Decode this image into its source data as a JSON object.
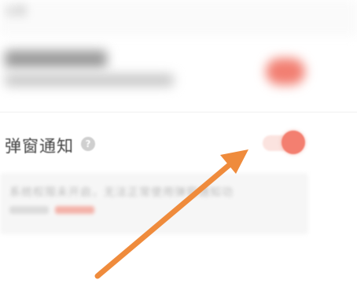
{
  "header": {
    "faint_text": "设置"
  },
  "settings": {
    "popup_notification": {
      "label": "弹窗通知",
      "help_icon_glyph": "?",
      "enabled": true
    },
    "notice": {
      "text": "系统权限未开启，无法正常使用弹窗通知功"
    }
  },
  "colors": {
    "accent": "#f37f70",
    "arrow": "#ef8b3c",
    "track": "#fbe3df"
  },
  "annotation": {
    "type": "arrow",
    "points_to": "popup-notification-toggle"
  }
}
